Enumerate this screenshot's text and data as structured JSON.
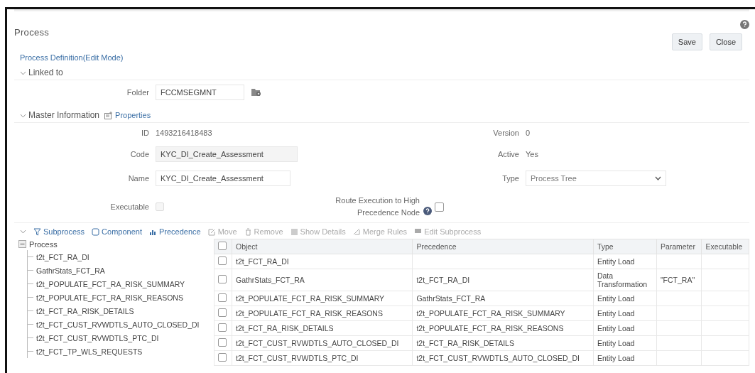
{
  "window": {
    "title": "Process"
  },
  "buttons": [
    "Save",
    "Close"
  ],
  "breadcrumb": "Process Definition(Edit Mode)",
  "linked_to": {
    "title": "Linked to",
    "expanded": true,
    "folder_label": "Folder",
    "folder_value": "FCCMSEGMNT"
  },
  "master": {
    "title": "Master Information",
    "expanded": true,
    "properties_link": "Properties",
    "id_label": "ID",
    "id_value": "1493216418483",
    "version_label": "Version",
    "version_value": "0",
    "code_label": "Code",
    "code_value": "KYC_DI_Create_Assessment",
    "active_label": "Active",
    "active_value": "Yes",
    "name_label": "Name",
    "name_value": "KYC_DI_Create_Assessment",
    "type_label": "Type",
    "type_value": "Process Tree",
    "executable_label": "Executable",
    "executable_checked": false,
    "executable_disabled": true,
    "route_label": "Route Execution to High Precedence Node",
    "route_checked": false
  },
  "toolbar": [
    {
      "label": "Subprocess",
      "kind": "filter",
      "disabled": false
    },
    {
      "label": "Component",
      "kind": "component",
      "disabled": false
    },
    {
      "label": "Precedence",
      "kind": "precedence",
      "disabled": false
    },
    {
      "label": "Move",
      "kind": "edit",
      "disabled": true
    },
    {
      "label": "Remove",
      "kind": "trash",
      "disabled": true
    },
    {
      "label": "Show Details",
      "kind": "details",
      "disabled": true
    },
    {
      "label": "Merge Rules",
      "kind": "merge",
      "disabled": true
    },
    {
      "label": "Edit Subprocess",
      "kind": "editsub",
      "disabled": true
    }
  ],
  "tree": {
    "label": "Process",
    "expanded": true,
    "children": [
      {
        "label": "t2t_FCT_RA_DI"
      },
      {
        "label": "GathrStats_FCT_RA"
      },
      {
        "label": "t2t_POPULATE_FCT_RA_RISK_SUMMARY"
      },
      {
        "label": "t2t_POPULATE_FCT_RA_RISK_REASONS"
      },
      {
        "label": "t2t_FCT_RA_RISK_DETAILS"
      },
      {
        "label": "t2t_FCT_CUST_RVWDTLS_AUTO_CLOSED_DI"
      },
      {
        "label": "t2t_FCT_CUST_RVWDTLS_PTC_DI"
      },
      {
        "label": "t2t_FCT_TP_WLS_REQUESTS"
      }
    ]
  },
  "table": {
    "columns": [
      "Object",
      "Precedence",
      "Type",
      "Parameter",
      "Executable"
    ],
    "header_checked": false,
    "rows": [
      {
        "checked": false,
        "object": "t2t_FCT_RA_DI",
        "precedence": "",
        "type": "Entity Load",
        "parameter": ""
      },
      {
        "checked": false,
        "object": "GathrStats_FCT_RA",
        "precedence": "t2t_FCT_RA_DI",
        "type": "Data Transformation",
        "parameter": "\"FCT_RA\""
      },
      {
        "checked": false,
        "object": "t2t_POPULATE_FCT_RA_RISK_SUMMARY",
        "precedence": "GathrStats_FCT_RA",
        "type": "Entity Load",
        "parameter": ""
      },
      {
        "checked": false,
        "object": "t2t_POPULATE_FCT_RA_RISK_REASONS",
        "precedence": "t2t_POPULATE_FCT_RA_RISK_SUMMARY",
        "type": "Entity Load",
        "parameter": ""
      },
      {
        "checked": false,
        "object": "t2t_FCT_RA_RISK_DETAILS",
        "precedence": "t2t_POPULATE_FCT_RA_RISK_REASONS",
        "type": "Entity Load",
        "parameter": ""
      },
      {
        "checked": false,
        "object": "t2t_FCT_CUST_RVWDTLS_AUTO_CLOSED_DI",
        "precedence": "t2t_FCT_RA_RISK_DETAILS",
        "type": "Entity Load",
        "parameter": ""
      },
      {
        "checked": false,
        "object": "t2t_FCT_CUST_RVWDTLS_PTC_DI",
        "precedence": "t2t_FCT_CUST_RVWDTLS_AUTO_CLOSED_DI",
        "type": "Entity Load",
        "parameter": ""
      }
    ]
  }
}
